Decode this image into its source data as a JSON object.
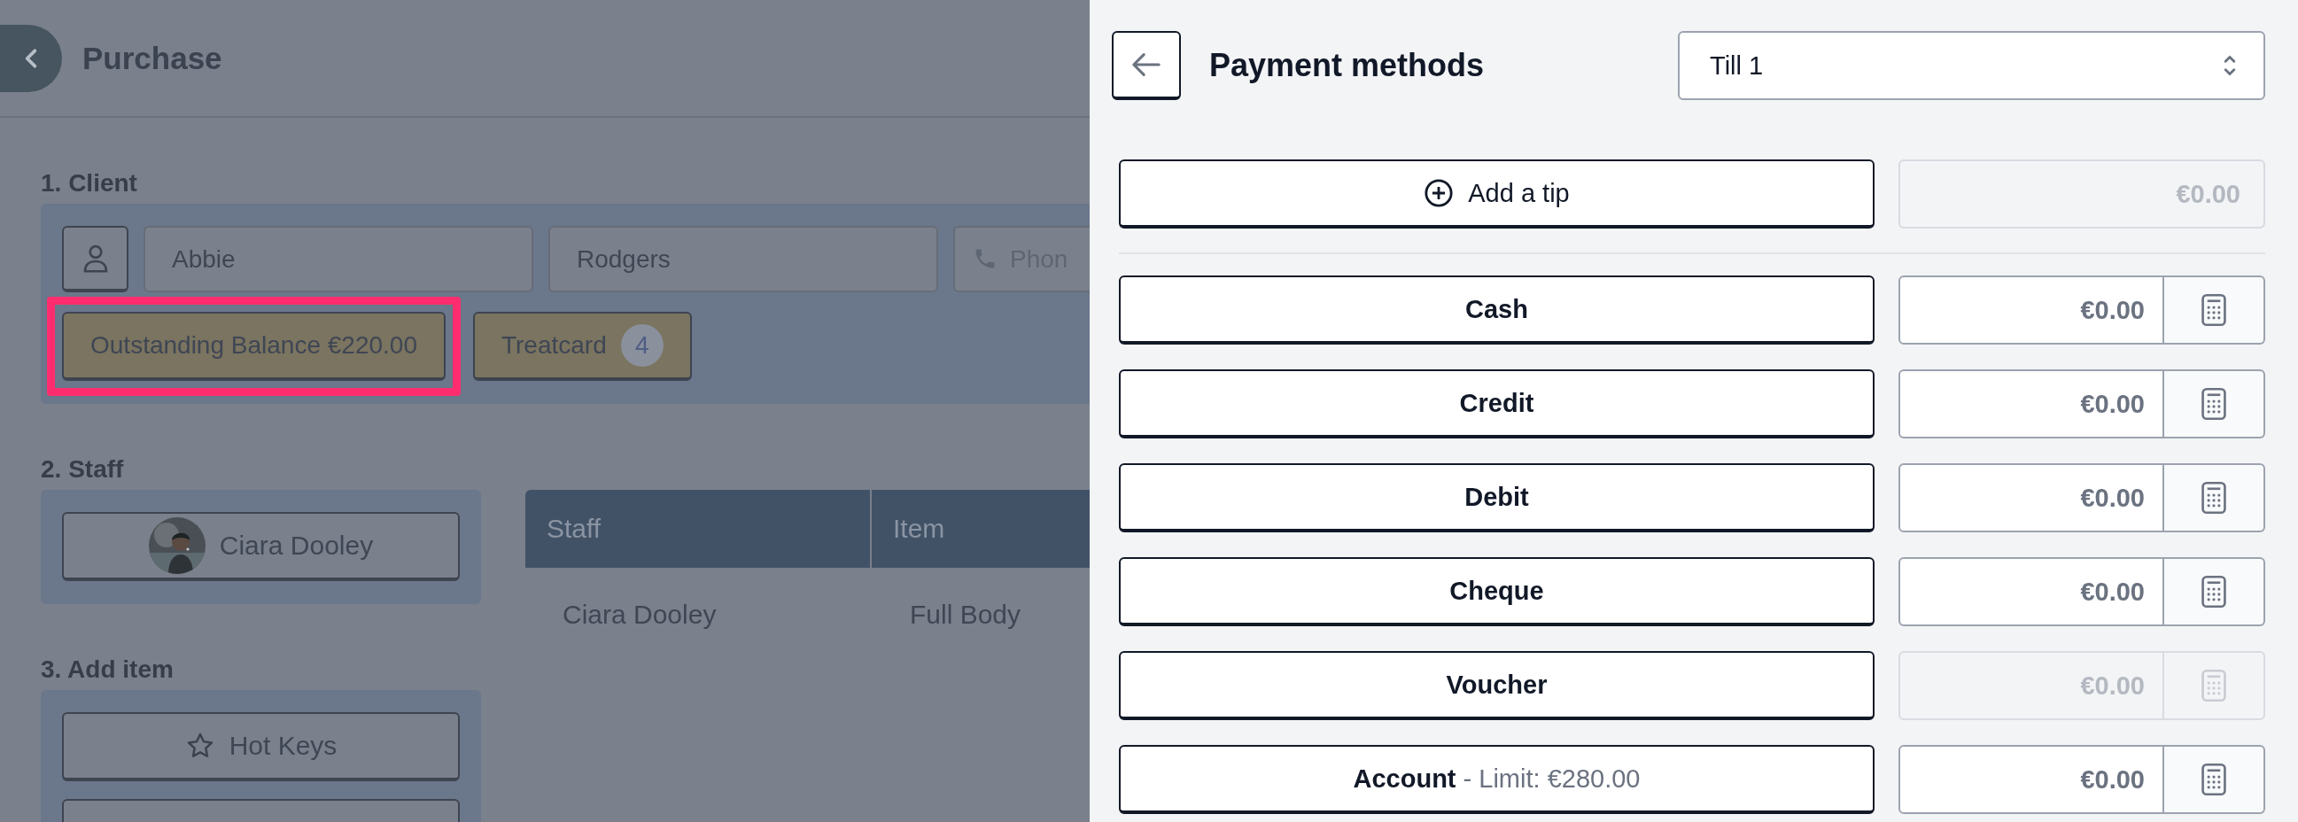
{
  "purchase": {
    "title": "Purchase",
    "client": {
      "heading": "1. Client",
      "first_name": "Abbie",
      "last_name": "Rodgers",
      "phone_placeholder": "Phon",
      "balance_button": {
        "label": "Outstanding Balance €220.00",
        "highlighted": true
      },
      "treatcard": {
        "label": "Treatcard",
        "count": "4"
      }
    },
    "staff": {
      "heading": "2. Staff",
      "member": "Ciara Dooley"
    },
    "table": {
      "columns": [
        "Staff",
        "Item"
      ],
      "rows": [
        [
          "Ciara Dooley",
          "Full Body"
        ]
      ]
    },
    "add_item": {
      "heading": "3. Add item",
      "buttons": [
        {
          "kind": "hotkeys",
          "label": "Hot Keys"
        },
        {
          "kind": "partial"
        }
      ]
    }
  },
  "payment": {
    "title": "Payment methods",
    "till": "Till 1",
    "tip": {
      "label": "Add a tip",
      "amount": "€0.00",
      "disabled": true
    },
    "methods": [
      {
        "label": "Cash",
        "amount": "€0.00",
        "disabled": false
      },
      {
        "label": "Credit",
        "amount": "€0.00",
        "disabled": false
      },
      {
        "label": "Debit",
        "amount": "€0.00",
        "disabled": false
      },
      {
        "label": "Cheque",
        "amount": "€0.00",
        "disabled": false
      },
      {
        "label": "Voucher",
        "amount": "€0.00",
        "disabled": true
      },
      {
        "label": "Account",
        "note": "- Limit: €280.00",
        "amount": "€0.00",
        "disabled": false
      }
    ]
  }
}
